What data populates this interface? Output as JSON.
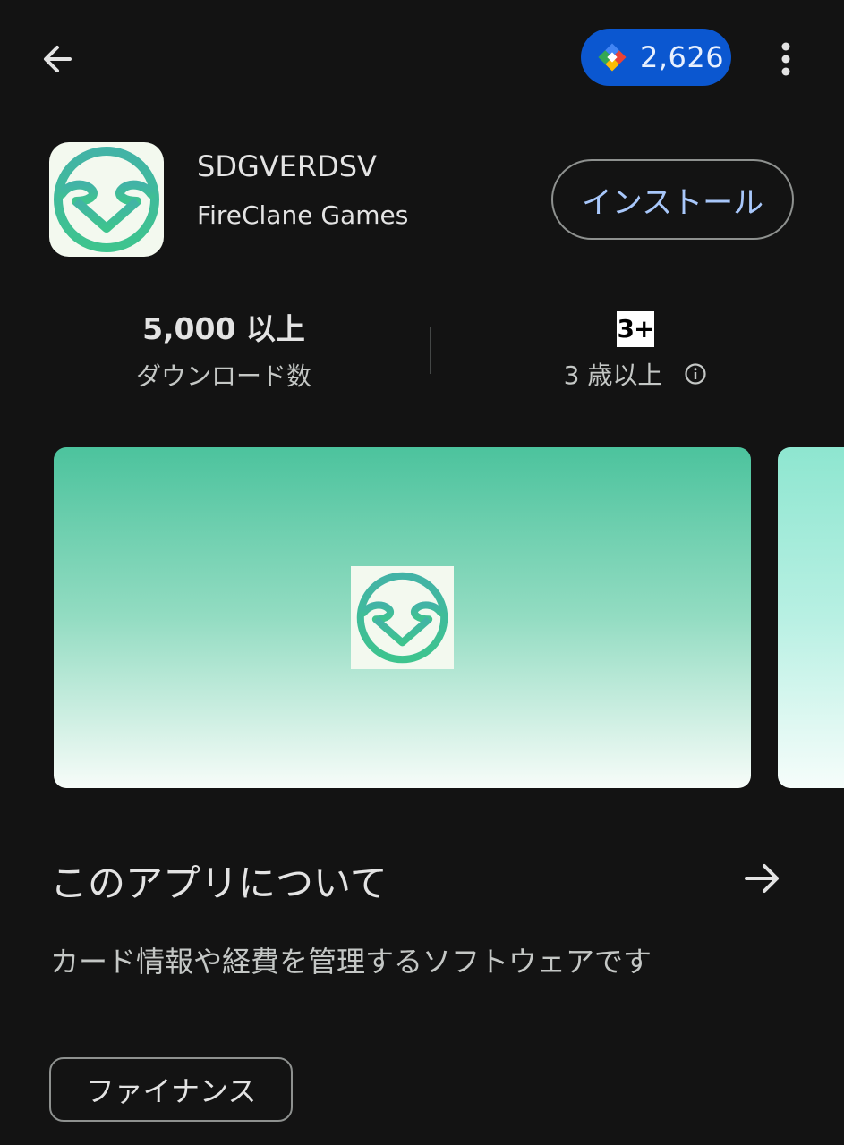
{
  "topbar": {
    "points_value": "2,626"
  },
  "app": {
    "title": "SDGVERDSV",
    "developer": "FireClane Games",
    "install_label": "インストール"
  },
  "stats": {
    "downloads_value": "5,000 以上",
    "downloads_label": "ダウンロード数",
    "rating_badge": "3+",
    "rating_label": "3 歳以上"
  },
  "about": {
    "title": "このアプリについて",
    "description": "カード情報や経費を管理するソフトウェアです"
  },
  "category": {
    "label": "ファイナンス"
  },
  "colors": {
    "background": "#131313",
    "points_pill": "#0b57d0",
    "install_text": "#a8c7fa",
    "logo_green": "#3fbf9a"
  },
  "icons": [
    "arrow-back-icon",
    "play-points-icon",
    "more-vert-icon",
    "info-icon",
    "arrow-forward-icon"
  ]
}
